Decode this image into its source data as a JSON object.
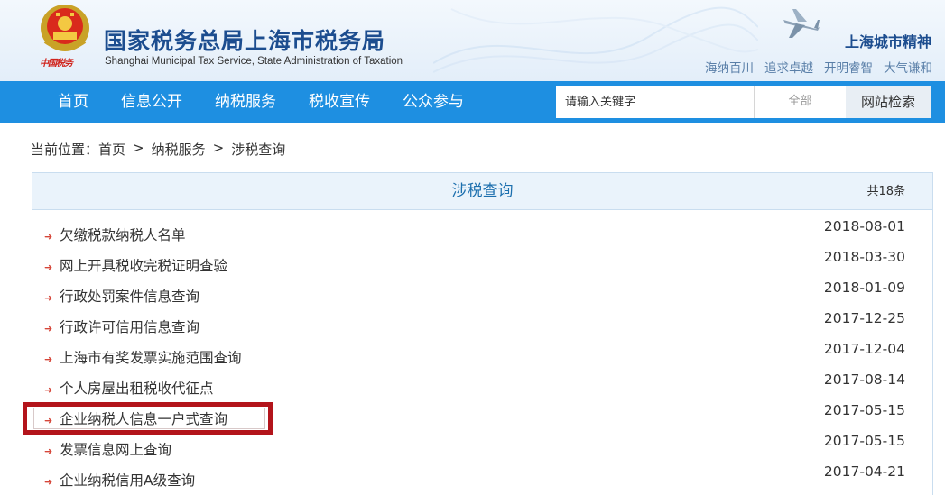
{
  "header": {
    "title": "国家税务总局上海市税务局",
    "subtitle": "Shanghai Municipal Tax Service, State Administration of Taxation",
    "logo_text": "中国税务",
    "city_spirit_title": "上海城市精神",
    "city_values": [
      "海纳百川",
      "追求卓越",
      "开明睿智",
      "大气谦和"
    ]
  },
  "nav": {
    "items": [
      "首页",
      "信息公开",
      "纳税服务",
      "税收宣传",
      "公众参与"
    ]
  },
  "search": {
    "placeholder": "请输入关键字",
    "scope": "全部",
    "button": "网站检索"
  },
  "breadcrumb": {
    "prefix": "当前位置：",
    "items": [
      "首页",
      "纳税服务",
      "涉税查询"
    ],
    "separator": ">"
  },
  "panel": {
    "title": "涉税查询",
    "count": "共18条",
    "rows": [
      {
        "title": "欠缴税款纳税人名单",
        "date": "2018-08-01"
      },
      {
        "title": "网上开具税收完税证明查验",
        "date": "2018-03-30"
      },
      {
        "title": "行政处罚案件信息查询",
        "date": "2018-01-09"
      },
      {
        "title": "行政许可信用信息查询",
        "date": "2017-12-25"
      },
      {
        "title": "上海市有奖发票实施范围查询",
        "date": "2017-12-04"
      },
      {
        "title": "个人房屋出租税收代征点",
        "date": "2017-08-14"
      },
      {
        "title": "企业纳税人信息一户式查询",
        "date": "2017-05-15"
      },
      {
        "title": "发票信息网上查询",
        "date": "2017-05-15"
      },
      {
        "title": "企业纳税信用A级查询",
        "date": "2017-04-21"
      }
    ]
  },
  "colors": {
    "nav_blue": "#1e8fe1",
    "title_blue": "#1c4d8f",
    "highlight_red": "#b3141b",
    "arrow_red": "#d6473a"
  }
}
